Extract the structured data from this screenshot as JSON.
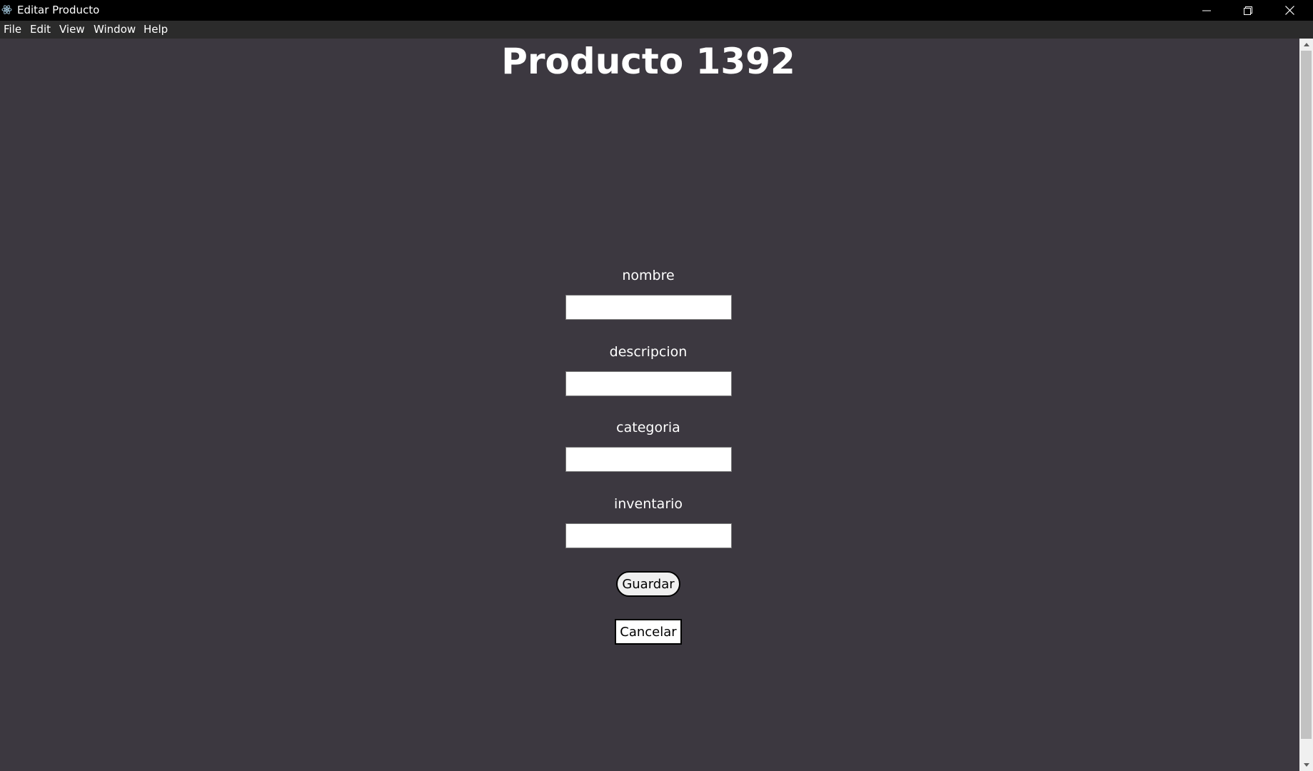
{
  "window": {
    "title": "Editar Producto",
    "app_icon": "electron-atom-icon",
    "controls": {
      "minimize": "minimize-icon",
      "maximize": "restore-icon",
      "close": "close-icon"
    }
  },
  "menubar": {
    "items": [
      "File",
      "Edit",
      "View",
      "Window",
      "Help"
    ]
  },
  "main": {
    "title": "Producto 1392",
    "fields": [
      {
        "label": "nombre",
        "value": ""
      },
      {
        "label": "descripcion",
        "value": ""
      },
      {
        "label": "categoria",
        "value": ""
      },
      {
        "label": "inventario",
        "value": ""
      }
    ],
    "save_label": "Guardar",
    "cancel_label": "Cancelar"
  },
  "colors": {
    "background": "#3c3840",
    "titlebar": "#000000",
    "menubar": "#2b2b2b",
    "text": "#ffffff"
  }
}
